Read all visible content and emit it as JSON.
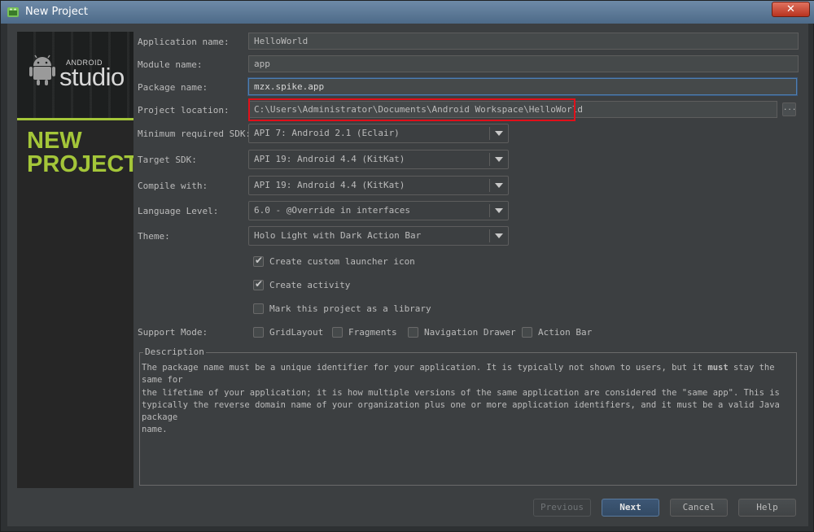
{
  "window": {
    "title": "New Project",
    "close_glyph": "✕"
  },
  "sidebar": {
    "brand_small": "ANDROID",
    "brand_big": "studio",
    "heading_lines": [
      "NEW",
      "PROJECT"
    ],
    "accent_color": "#a4c639"
  },
  "form": {
    "app_name": {
      "label": "Application name:",
      "value": "HelloWorld"
    },
    "module_name": {
      "label": "Module name:",
      "value": "app"
    },
    "package_name": {
      "label": "Package name:",
      "value": "mzx.spike.app"
    },
    "project_location": {
      "label": "Project location:",
      "value": "C:\\Users\\Administrator\\Documents\\Android Workspace\\HelloWorld",
      "browse_label": "..."
    },
    "min_sdk": {
      "label": "Minimum required SDK:",
      "value": "API 7: Android 2.1 (Eclair)"
    },
    "target_sdk": {
      "label": "Target SDK:",
      "value": "API 19: Android 4.4 (KitKat)"
    },
    "compile_with": {
      "label": "Compile with:",
      "value": "API 19: Android 4.4 (KitKat)"
    },
    "language_level": {
      "label": "Language Level:",
      "value": "6.0 - @Override in interfaces"
    },
    "theme": {
      "label": "Theme:",
      "value": "Holo Light with Dark Action Bar"
    },
    "options": [
      {
        "label": "Create custom launcher icon",
        "checked": true
      },
      {
        "label": "Create activity",
        "checked": true
      },
      {
        "label": "Mark this project as a library",
        "checked": false
      }
    ],
    "support_mode": {
      "label": "Support Mode:",
      "items": [
        {
          "label": "GridLayout",
          "checked": false
        },
        {
          "label": "Fragments",
          "checked": false
        },
        {
          "label": "Navigation Drawer",
          "checked": false
        },
        {
          "label": "Action Bar",
          "checked": false
        }
      ]
    }
  },
  "description": {
    "title": "Description",
    "text_before": "The package name must be a unique identifier for your application. It is typically not shown to users, but it ",
    "text_bold": "must",
    "text_after": " stay the same for\nthe lifetime of your application; it is how multiple versions of the same application are considered the \"same app\". This is\ntypically the reverse domain name of your organization plus one or more application identifiers, and it must be a valid Java package\nname."
  },
  "buttons": {
    "previous": "Previous",
    "next": "Next",
    "cancel": "Cancel",
    "help": "Help"
  },
  "colors": {
    "highlight": "#e0101a",
    "focus": "#4f7fb2"
  }
}
